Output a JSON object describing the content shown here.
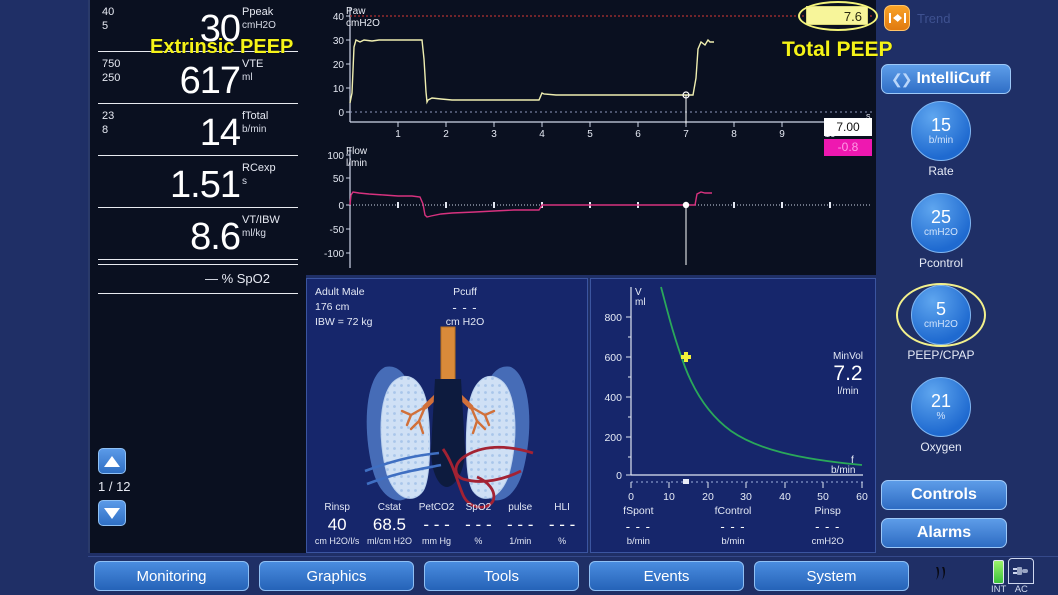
{
  "numeric_panel": {
    "rows": [
      {
        "hi": "40",
        "lo": "5",
        "value": "30",
        "label": "Ppeak",
        "unit": "cmH2O"
      },
      {
        "hi": "750",
        "lo": "250",
        "value": "617",
        "label": "VTE",
        "unit": "ml"
      },
      {
        "hi": "23",
        "lo": "8",
        "value": "14",
        "label": "fTotal",
        "unit": "b/min"
      },
      {
        "hi": "",
        "lo": "",
        "value": "1.51",
        "label": "RCexp",
        "unit": "s"
      },
      {
        "hi": "",
        "lo": "",
        "value": "8.6",
        "label": "VT/IBW",
        "unit": "ml/kg"
      }
    ],
    "spo2_text": "—  % SpO2",
    "page_indicator": "1 / 12"
  },
  "waveforms": {
    "paw": {
      "title": "Paw",
      "unit": "cmH2O",
      "y_ticks": [
        "40",
        "30",
        "20",
        "10",
        "0"
      ],
      "x_ticks": [
        "1",
        "2",
        "3",
        "4",
        "5",
        "6",
        "7",
        "8",
        "9",
        "10"
      ],
      "x_unit": "s",
      "cursor_value": "7.00",
      "trace_color": "#efeeb0",
      "alarm_line_color": "#b03030"
    },
    "flow": {
      "title": "Flow",
      "unit": "l/min",
      "y_ticks": [
        "100",
        "50",
        "0",
        "-50",
        "-100"
      ],
      "cursor_value": "-0.8",
      "trace_color": "#d8327f"
    },
    "total_peep": {
      "chip_value": "7.6",
      "annotation": "Total PEEP",
      "annotation_color": "#f5f318"
    }
  },
  "patient_panel": {
    "patient_type": "Adult Male",
    "height": "176 cm",
    "ibw": "IBW = 72 kg",
    "pcuff_label": "Pcuff",
    "pcuff_value": "- - -",
    "pcuff_unit": "cm H2O",
    "stats": [
      {
        "title": "Rinsp",
        "value": "40",
        "unit": "cm H2O/l/s"
      },
      {
        "title": "Cstat",
        "value": "68.5",
        "unit": "ml/cm H2O"
      },
      {
        "title": "PetCO2",
        "value": "- - -",
        "unit": "mm Hg"
      },
      {
        "title": "SpO2",
        "value": "- - -",
        "unit": "%"
      },
      {
        "title": "pulse",
        "value": "- - -",
        "unit": "1/min"
      },
      {
        "title": "HLI",
        "value": "- - -",
        "unit": "%"
      }
    ]
  },
  "minvol_panel": {
    "y_label": "V",
    "y_unit": "ml",
    "x_label": "f",
    "x_unit": "b/min",
    "y_ticks": [
      "800",
      "600",
      "400",
      "200",
      "0"
    ],
    "x_ticks": [
      "0",
      "10",
      "20",
      "30",
      "40",
      "50",
      "60"
    ],
    "readout_title": "MinVol",
    "readout_value": "7.2",
    "readout_unit": "l/min",
    "annotation": "Extrinsic PEEP",
    "annotation_color": "#f5f318",
    "curve_color": "#2aa85a",
    "marker_color": "#f2f23a",
    "bottom": [
      {
        "title": "fSpont",
        "value": "- - -",
        "unit": "b/min"
      },
      {
        "title": "fControl",
        "value": "- - -",
        "unit": "b/min"
      },
      {
        "title": "Pinsp",
        "value": "- - -",
        "unit": "cmH2O"
      }
    ]
  },
  "sidebar": {
    "trend_label": "Trend",
    "intellicuff_label": "IntelliCuff",
    "knobs": [
      {
        "value": "15",
        "unit": "b/min",
        "caption": "Rate"
      },
      {
        "value": "25",
        "unit": "cmH2O",
        "caption": "Pcontrol"
      },
      {
        "value": "5",
        "unit": "cmH2O",
        "caption": "PEEP/CPAP"
      },
      {
        "value": "21",
        "unit": "%",
        "caption": "Oxygen"
      }
    ],
    "controls_label": "Controls",
    "alarms_label": "Alarms"
  },
  "bottom_bar": {
    "nav": [
      "Monitoring",
      "Graphics",
      "Tools",
      "Events",
      "System"
    ],
    "battery_label": "INT",
    "ac_label": "AC"
  },
  "chart_data": [
    {
      "type": "line",
      "title": "Paw",
      "ylabel": "cmH2O",
      "xlabel": "s",
      "ylim": [
        -8,
        45
      ],
      "xlim": [
        0,
        10.7
      ],
      "yticks": [
        0,
        10,
        20,
        30,
        40
      ],
      "xticks": [
        1,
        2,
        3,
        4,
        5,
        6,
        7,
        8,
        9,
        10
      ],
      "alarm_limit": 40,
      "cursor_x": 7.0,
      "cursor_value": 7.6,
      "series": [
        {
          "name": "Paw",
          "points": [
            [
              0.0,
              4
            ],
            [
              0.04,
              8
            ],
            [
              0.08,
              27
            ],
            [
              0.12,
              30
            ],
            [
              0.2,
              29
            ],
            [
              0.3,
              30
            ],
            [
              0.45,
              29.5
            ],
            [
              0.6,
              30
            ],
            [
              0.8,
              30
            ],
            [
              1.0,
              30
            ],
            [
              1.2,
              30
            ],
            [
              1.4,
              30
            ],
            [
              1.46,
              30
            ],
            [
              1.5,
              22
            ],
            [
              1.54,
              8
            ],
            [
              1.58,
              4
            ],
            [
              1.62,
              5
            ],
            [
              1.7,
              6
            ],
            [
              1.9,
              5.5
            ],
            [
              2.2,
              5
            ],
            [
              2.6,
              5
            ],
            [
              3.0,
              5
            ],
            [
              3.4,
              5
            ],
            [
              3.6,
              5
            ],
            [
              3.9,
              5
            ],
            [
              3.95,
              5
            ],
            [
              4.0,
              8
            ],
            [
              4.05,
              7.5
            ],
            [
              4.3,
              7
            ],
            [
              4.8,
              7
            ],
            [
              5.4,
              7
            ],
            [
              6.0,
              7
            ],
            [
              6.5,
              7
            ],
            [
              7.0,
              7
            ],
            [
              7.15,
              7
            ],
            [
              7.2,
              14
            ],
            [
              7.25,
              26
            ],
            [
              7.3,
              29
            ],
            [
              7.38,
              28
            ],
            [
              7.45,
              30
            ],
            [
              7.5,
              29
            ],
            [
              7.58,
              29
            ]
          ]
        }
      ]
    },
    {
      "type": "line",
      "title": "Flow",
      "ylabel": "l/min",
      "xlabel": "s",
      "ylim": [
        -130,
        115
      ],
      "xlim": [
        0,
        10.7
      ],
      "yticks": [
        -100,
        -50,
        0,
        50,
        100
      ],
      "cursor_x": 7.0,
      "cursor_value": -0.8,
      "series": [
        {
          "name": "Flow",
          "points": [
            [
              0.0,
              0
            ],
            [
              0.03,
              22
            ],
            [
              0.06,
              28
            ],
            [
              0.2,
              26
            ],
            [
              0.4,
              24
            ],
            [
              0.7,
              22
            ],
            [
              1.0,
              20
            ],
            [
              1.3,
              19
            ],
            [
              1.45,
              18
            ],
            [
              1.5,
              2
            ],
            [
              1.55,
              -22
            ],
            [
              1.6,
              -26
            ],
            [
              1.7,
              -24
            ],
            [
              1.9,
              -20
            ],
            [
              2.2,
              -17
            ],
            [
              2.6,
              -15
            ],
            [
              3.0,
              -13
            ],
            [
              3.4,
              -12
            ],
            [
              3.7,
              -11
            ],
            [
              3.95,
              -10
            ],
            [
              4.0,
              0
            ],
            [
              4.5,
              0
            ],
            [
              5.0,
              0
            ],
            [
              6.0,
              0
            ],
            [
              7.0,
              0
            ],
            [
              7.18,
              0
            ],
            [
              7.22,
              22
            ],
            [
              7.3,
              26
            ],
            [
              7.4,
              25
            ],
            [
              7.55,
              25
            ]
          ]
        }
      ]
    },
    {
      "type": "line",
      "title": "MinVol (V vs f)",
      "ylabel": "V ml",
      "xlabel": "f b/min",
      "xlim": [
        0,
        60
      ],
      "ylim": [
        0,
        900
      ],
      "yticks": [
        0,
        200,
        400,
        600,
        800
      ],
      "xticks": [
        0,
        10,
        20,
        30,
        40,
        50,
        60
      ],
      "minvol_lmin": 7.2,
      "marker": {
        "x": 14,
        "y": 617
      },
      "series": [
        {
          "name": "MinVol 7.2 l/min isopleth",
          "points": [
            [
              7.8,
              900
            ],
            [
              9,
              800
            ],
            [
              10,
              720
            ],
            [
              12,
              600
            ],
            [
              14,
              514
            ],
            [
              16,
              450
            ],
            [
              18,
              400
            ],
            [
              20,
              360
            ],
            [
              24,
              300
            ],
            [
              28,
              257
            ],
            [
              32,
              225
            ],
            [
              36,
              200
            ],
            [
              40,
              180
            ],
            [
              45,
              160
            ],
            [
              50,
              144
            ],
            [
              55,
              131
            ],
            [
              60,
              120
            ]
          ]
        }
      ]
    }
  ]
}
